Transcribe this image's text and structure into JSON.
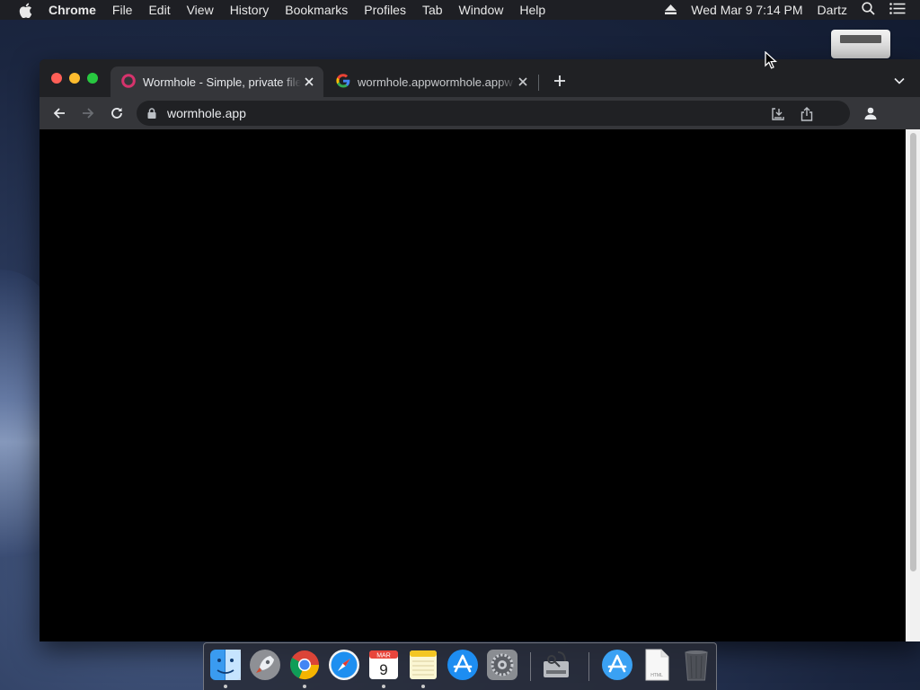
{
  "menubar": {
    "apple_icon": "apple-icon",
    "app_name": "Chrome",
    "items": [
      "File",
      "Edit",
      "View",
      "History",
      "Bookmarks",
      "Profiles",
      "Tab",
      "Window",
      "Help"
    ],
    "datetime": "Wed Mar 9  7:14 PM",
    "user": "Dartz"
  },
  "browser": {
    "tabs": [
      {
        "title": "Wormhole - Simple, private file",
        "favicon": "wormhole-favicon",
        "active": true
      },
      {
        "title": "wormhole.appwormhole.appw",
        "favicon": "google-favicon",
        "active": false
      }
    ],
    "address": "wormhole.app"
  },
  "dock": {
    "items": [
      {
        "name": "Finder",
        "icon": "finder-icon"
      },
      {
        "name": "Launchpad",
        "icon": "launchpad-icon"
      },
      {
        "name": "Google Chrome",
        "icon": "chrome-icon"
      },
      {
        "name": "Safari",
        "icon": "safari-icon"
      },
      {
        "name": "Calendar",
        "icon": "calendar-icon",
        "month": "MAR",
        "day": "9"
      },
      {
        "name": "Notes",
        "icon": "notes-icon"
      },
      {
        "name": "App Store",
        "icon": "app-store-icon"
      },
      {
        "name": "System Preferences",
        "icon": "system-preferences-icon"
      },
      {
        "name": "Disk Utility",
        "icon": "disk-utility-icon"
      },
      {
        "name": "Applications",
        "icon": "applications-folder-icon"
      },
      {
        "name": "HTML Document",
        "icon": "html-file-icon",
        "label": "HTML"
      },
      {
        "name": "Trash",
        "icon": "trash-icon"
      }
    ]
  },
  "colors": {
    "menubar_bg": "#1e1f24",
    "tab_active_bg": "#35363a",
    "tabstrip_bg": "#202124",
    "content_bg": "#000000",
    "wormhole_accent": "#d6336c"
  }
}
